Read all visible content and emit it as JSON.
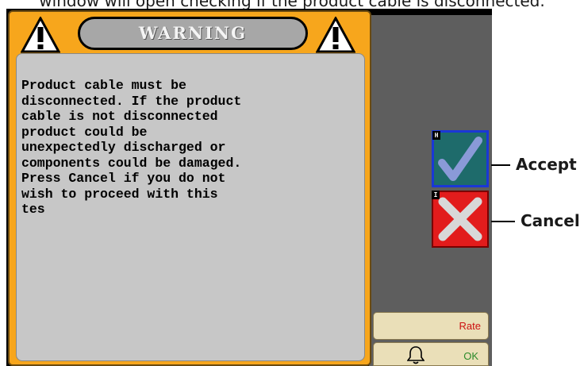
{
  "caption": "window will open checking if the product cable is disconnected.",
  "dialog": {
    "title": "WARNING",
    "message": "Product cable must be\ndisconnected. If the product\ncable is not disconnected\nproduct could be\nunexpectedly discharged or\ncomponents could be damaged.\nPress Cancel if you do not\nwish to proceed with this\ntes",
    "icon": "warning-triangle-icon"
  },
  "softkeys": {
    "accept": {
      "letter": "H",
      "icon": "checkmark-icon",
      "color": "#1e6b6b"
    },
    "cancel": {
      "letter": "I",
      "icon": "x-icon",
      "color": "#e21c1c"
    }
  },
  "callouts": {
    "accept": "Accept",
    "cancel": "Cancel"
  },
  "buttons": {
    "rate": "Rate",
    "ok": "OK",
    "bell_icon": "bell-icon"
  }
}
